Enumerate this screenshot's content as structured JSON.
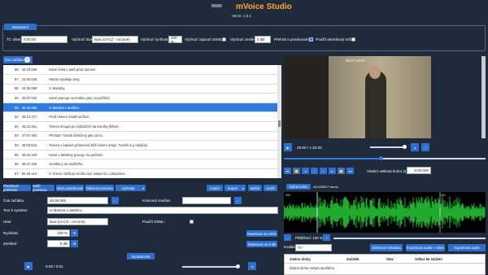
{
  "app": {
    "title": "mVoice Studio",
    "version": "Verze: 1.0.1",
    "logo_text": "lMtMl"
  },
  "settings": {
    "panel_label": "Nastavení",
    "tc_start_label": "TC ofset:",
    "tc_start_value": "0:00:00",
    "voice_label": "Výchozí hlas:",
    "voice_value": "lana (cs-CZ - mrzoné)",
    "speed_label": "Výchozí rychlost:",
    "speed_value": "100 %",
    "ssml_label": "Výchozí zapnutí SSML:",
    "gain_label": "Výchozí zesílení:",
    "gain_value": "0 dB",
    "pause_label": "Přehrát s promluvami:",
    "subtitle_mode_label": "Použít atmníkový režim:"
  },
  "list": {
    "filter_label": "Čas začátku",
    "rows": [
      {
        "num": "86",
        "time": "42:19.535",
        "text": "Karel čeká v autě před domem."
      },
      {
        "num": "87",
        "time": "43:05.535",
        "text": "Martin vybaluje boty."
      },
      {
        "num": "88",
        "time": "44:36.596",
        "text": "U Markéty."
      },
      {
        "num": "89",
        "time": "45:07.034",
        "text": "Karel pracuje na mobilu jako na počítači."
      },
      {
        "num": "90",
        "time": "45:46.055",
        "text": "U Martina v ateliéru."
      },
      {
        "num": "91",
        "time": "46:14.717",
        "text": "Před oknem zatáhnul žlutí."
      },
      {
        "num": "92",
        "time": "46:22.261",
        "text": "Tereza stoupá po schůdcích na korolky štěvet."
      },
      {
        "num": "93",
        "time": "47:07.484",
        "text": "Přichází Tomáš oblečený jako princ."
      },
      {
        "num": "94",
        "time": "49:03.518",
        "text": "Tereza v bakách přinesená běží kolem orloje. Turistů si ji natáčejí."
      },
      {
        "num": "95",
        "time": "49:25.229",
        "text": "Karel u Markéty pracuje na počítači."
      },
      {
        "num": "96",
        "time": "49:37.435",
        "text": "Soušká ji do vzpětí/hu."
      },
      {
        "num": "97",
        "time": "50:29.414",
        "text": "K Tereze zaříhají chodit noví zákazníci i zákaznice."
      }
    ],
    "selected_index": 4
  },
  "list_toolbar": {
    "prev": "Předchozí promluva",
    "next": "Další promluva",
    "jump_prev": "Skrýt podrobnosti",
    "jump_next": "Odkázat promluvu",
    "delete": "Vyhledat",
    "import": "Import",
    "export": "Export",
    "load": "Načíst",
    "save": "Uložit"
  },
  "editor": {
    "start_label": "Čas začátku:",
    "start_value": "45:46.055",
    "end_label": "Koncová značka:",
    "text_label": "Text k syntéze:",
    "text_value": "U Martina v ateliéru.",
    "voice_label": "Hlas:",
    "voice_value": "lana (cs-CZ - mrzoné)",
    "ssml_label": "Použít SSML:",
    "speed_label": "Rychlost:",
    "speed_value": "100 %",
    "reset_speed": "Resetovat na 100%",
    "gain_label": "Zesílení:",
    "gain_value": "0 dB",
    "reset_gain": "Resetovat na 0 dB",
    "synth": "Syntetizovat",
    "time": "0:00 / 0:01"
  },
  "video": {
    "overlay_tc": "00:47:10:57",
    "time": "45:50 / 1:32:20",
    "step_label": "Vlastní velikost kroku (s):",
    "step_value": "0:00:000"
  },
  "wave": {
    "tab": "Vybrat ledan",
    "marker_label": "ACO00517 nemu",
    "labels": [
      "090",
      "091"
    ]
  },
  "playback": {
    "zoom_label": "Přiblížení:",
    "zoom_value": "100 %",
    "quality_label": "Kvalita:",
    "quality_value": "TV",
    "btn_meta": "Stáhnout metadata",
    "btn_export_all": "Exportovat audio + video",
    "btn_export": "Exportovat audio"
  },
  "issues": {
    "col1": "Jméno úlohy",
    "col2": "Začátek",
    "col3": "Stav",
    "col4": "Odkaz ke stažení",
    "empty": "Žádná úloha nebyla spuštěna"
  }
}
